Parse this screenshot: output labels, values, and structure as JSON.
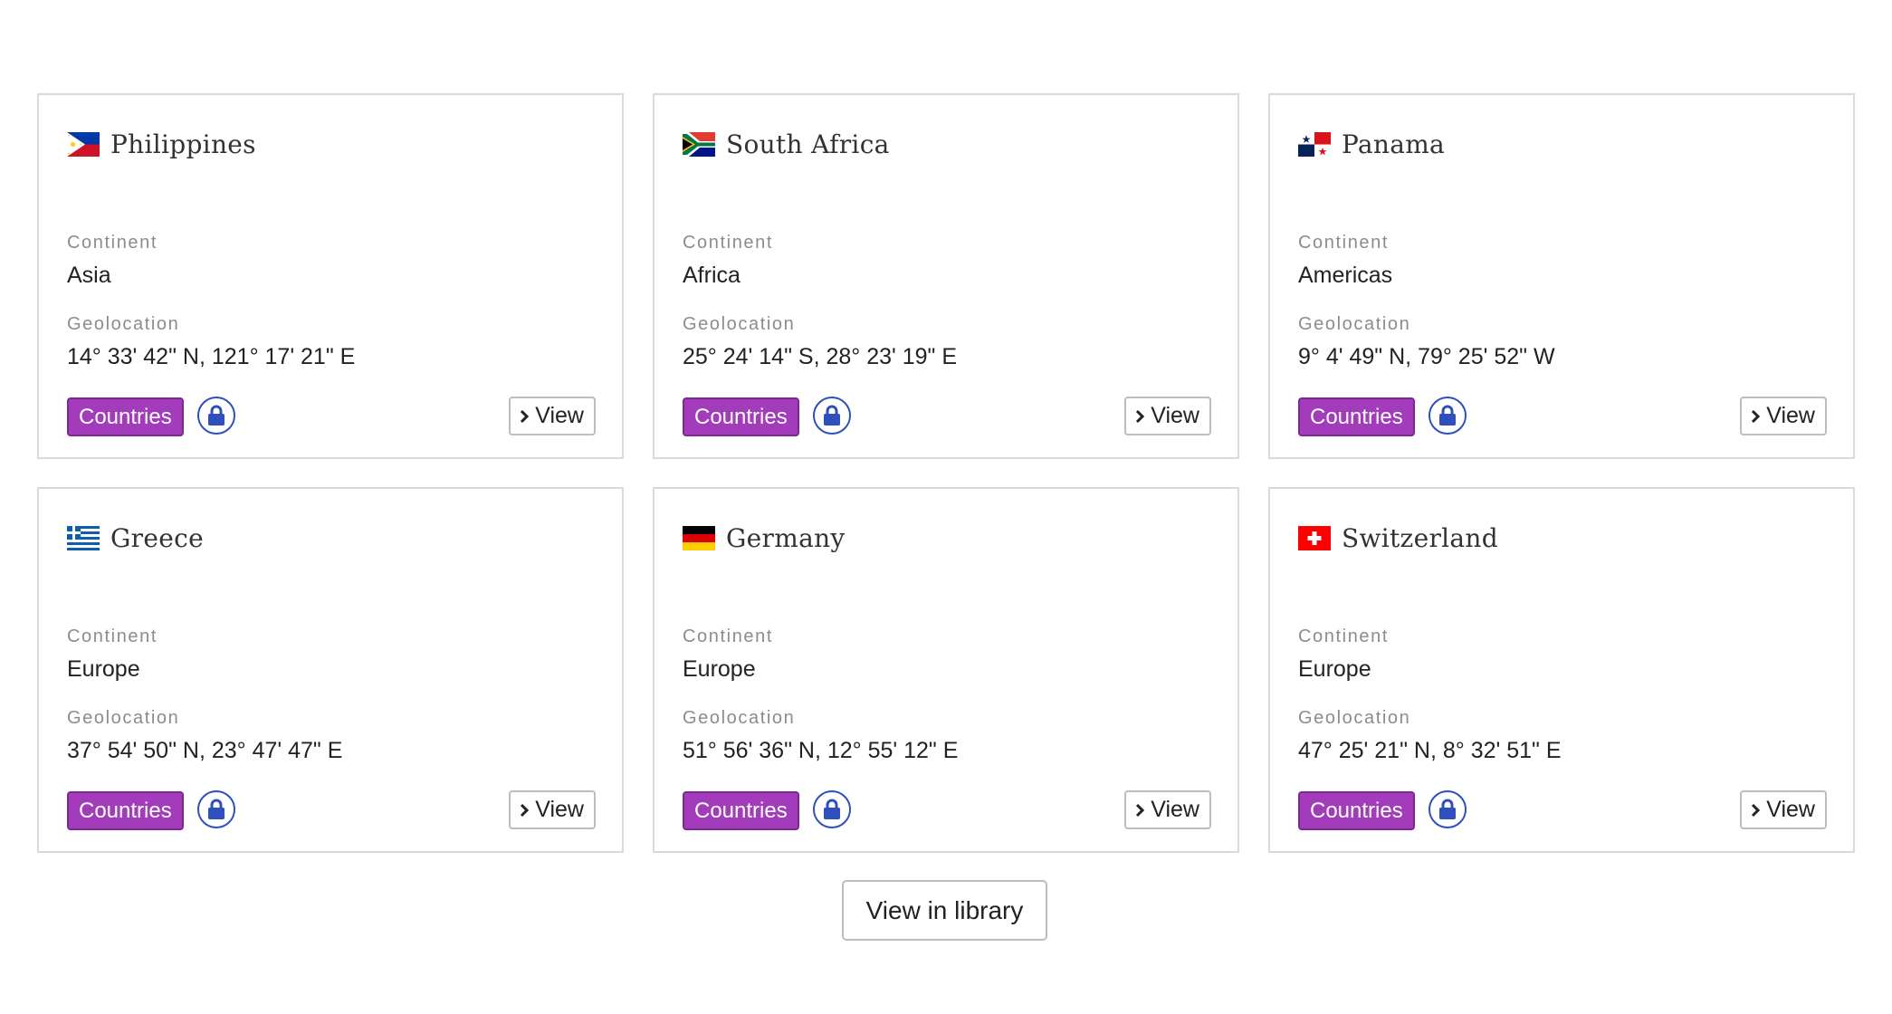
{
  "cards": [
    {
      "name": "Philippines",
      "flag_icon": "philippines-flag-icon",
      "continent_label": "Continent",
      "continent": "Asia",
      "geolocation_label": "Geolocation",
      "geolocation": "14° 33' 42\" N, 121° 17' 21\" E",
      "tag_label": "Countries",
      "lock_icon": "lock-icon",
      "view_label": "View"
    },
    {
      "name": "South Africa",
      "flag_icon": "south-africa-flag-icon",
      "continent_label": "Continent",
      "continent": "Africa",
      "geolocation_label": "Geolocation",
      "geolocation": "25° 24' 14\" S, 28° 23' 19\" E",
      "tag_label": "Countries",
      "lock_icon": "lock-icon",
      "view_label": "View"
    },
    {
      "name": "Panama",
      "flag_icon": "panama-flag-icon",
      "continent_label": "Continent",
      "continent": "Americas",
      "geolocation_label": "Geolocation",
      "geolocation": "9° 4' 49\" N, 79° 25' 52\" W",
      "tag_label": "Countries",
      "lock_icon": "lock-icon",
      "view_label": "View"
    },
    {
      "name": "Greece",
      "flag_icon": "greece-flag-icon",
      "continent_label": "Continent",
      "continent": "Europe",
      "geolocation_label": "Geolocation",
      "geolocation": "37° 54' 50\" N, 23° 47' 47\" E",
      "tag_label": "Countries",
      "lock_icon": "lock-icon",
      "view_label": "View"
    },
    {
      "name": "Germany",
      "flag_icon": "germany-flag-icon",
      "continent_label": "Continent",
      "continent": "Europe",
      "geolocation_label": "Geolocation",
      "geolocation": "51° 56' 36\" N, 12° 55' 12\" E",
      "tag_label": "Countries",
      "lock_icon": "lock-icon",
      "view_label": "View"
    },
    {
      "name": "Switzerland",
      "flag_icon": "switzerland-flag-icon",
      "continent_label": "Continent",
      "continent": "Europe",
      "geolocation_label": "Geolocation",
      "geolocation": "47° 25' 21\" N, 8° 32' 51\" E",
      "tag_label": "Countries",
      "lock_icon": "lock-icon",
      "view_label": "View"
    }
  ],
  "footer": {
    "library_button_label": "View in library"
  },
  "colors": {
    "tag_background": "#a23cbb",
    "lock_accent": "#2f4fba",
    "card_border": "#dadada"
  }
}
